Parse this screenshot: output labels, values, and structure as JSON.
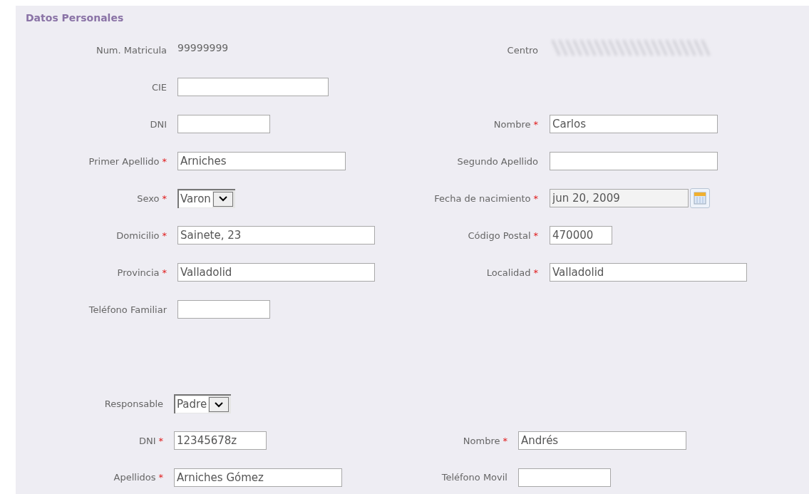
{
  "section_title": "Datos Personales",
  "required_mark": "*",
  "student_rows": [
    {
      "left": {
        "label": "Num. Matricula",
        "required": false,
        "kind": "static",
        "value": "99999999"
      },
      "right": {
        "label": "Centro",
        "required": false,
        "kind": "redacted"
      }
    },
    {
      "left": {
        "label": "CIE",
        "required": false,
        "kind": "text"
      }
    },
    {
      "left": {
        "label": "DNI",
        "required": false,
        "kind": "text"
      },
      "right": {
        "label": "Nombre",
        "required": true,
        "kind": "text",
        "value": "Carlos"
      }
    },
    {
      "left": {
        "label": "Primer Apellido",
        "required": true,
        "kind": "text",
        "value": "Arniches"
      },
      "right": {
        "label": "Segundo Apellido",
        "required": false,
        "kind": "text"
      }
    },
    {
      "left": {
        "label": "Sexo",
        "required": true,
        "kind": "select",
        "value": "Varon"
      },
      "right": {
        "label": "Fecha de nacimiento",
        "required": true,
        "kind": "date",
        "value": "jun 20, 2009"
      }
    },
    {
      "left": {
        "label": "Domicilio",
        "required": true,
        "kind": "text",
        "value": "Sainete, 23"
      },
      "right": {
        "label": "Código Postal",
        "required": true,
        "kind": "text",
        "value": "470000"
      }
    },
    {
      "left": {
        "label": "Provincia",
        "required": true,
        "kind": "text",
        "value": "Valladolid"
      },
      "right": {
        "label": "Localidad",
        "required": true,
        "kind": "text",
        "value": "Valladolid"
      }
    },
    {
      "left": {
        "label": "Teléfono Familiar",
        "required": false,
        "kind": "text"
      }
    }
  ],
  "guardian_rows": [
    {
      "left": {
        "label": "Responsable",
        "required": false,
        "kind": "select",
        "value": "Padre"
      }
    },
    {
      "left": {
        "label": "DNI",
        "required": true,
        "kind": "text",
        "value": "12345678z"
      },
      "right": {
        "label": "Nombre",
        "required": true,
        "kind": "text",
        "value": "Andrés"
      }
    },
    {
      "left": {
        "label": "Apellidos",
        "required": true,
        "kind": "text",
        "value": "Arniches Gómez"
      },
      "right": {
        "label": "Teléfono Movil",
        "required": false,
        "kind": "text"
      }
    }
  ]
}
